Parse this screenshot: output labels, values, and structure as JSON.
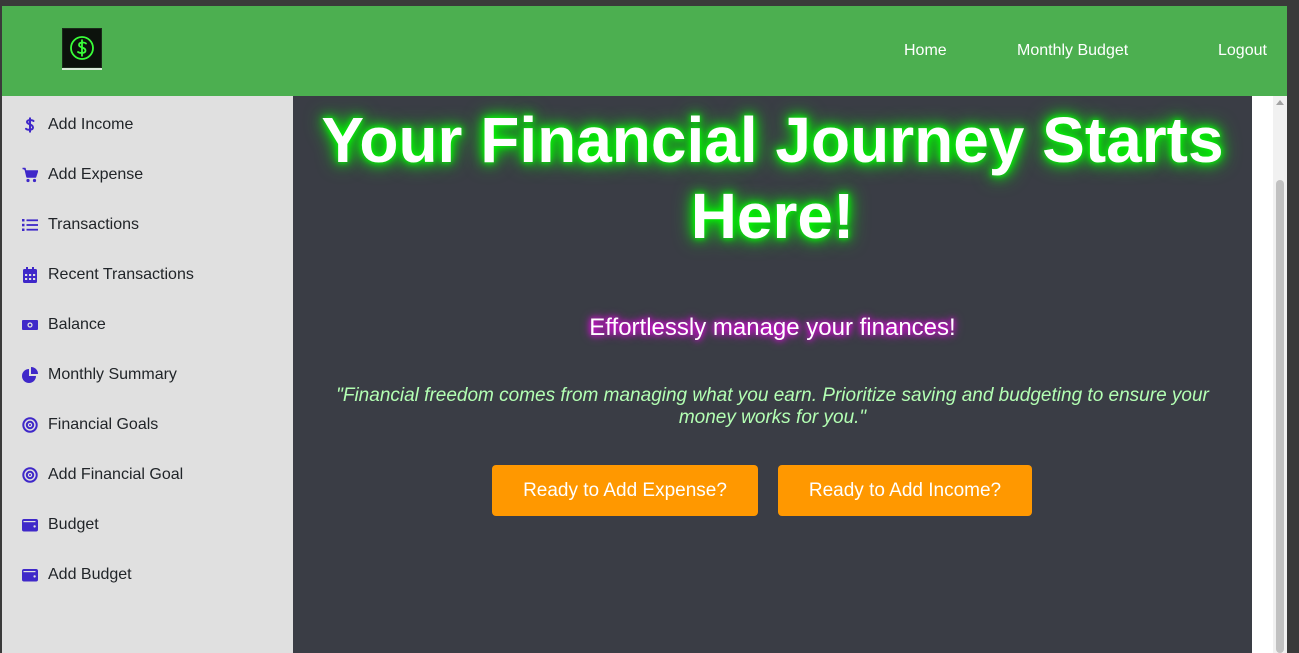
{
  "navbar": {
    "logo_icon": "dollar-sign-neon-icon",
    "background": "#4caf50",
    "links": {
      "home": "Home",
      "monthly_budget": "Monthly Budget",
      "logout": "Logout"
    }
  },
  "sidebar": {
    "items": [
      {
        "label": "Add Income",
        "icon": "dollar-icon"
      },
      {
        "label": "Add Expense",
        "icon": "cart-icon"
      },
      {
        "label": "Transactions",
        "icon": "list-icon"
      },
      {
        "label": "Recent Transactions",
        "icon": "calendar-icon"
      },
      {
        "label": "Balance",
        "icon": "money-bill-icon"
      },
      {
        "label": "Monthly Summary",
        "icon": "pie-chart-icon"
      },
      {
        "label": "Financial Goals",
        "icon": "target-icon"
      },
      {
        "label": "Add Financial Goal",
        "icon": "target-icon"
      },
      {
        "label": "Budget",
        "icon": "wallet-icon"
      },
      {
        "label": "Add Budget",
        "icon": "wallet-icon"
      }
    ],
    "icon_color": "#3f28c9"
  },
  "main": {
    "title_line1": "Your Financial Journey Starts",
    "title_line2": "Here!",
    "subtitle": "Effortlessly manage your finances!",
    "quote": "\"Financial freedom comes from managing what you earn. Prioritize saving and budgeting to ensure your money works for you.\"",
    "buttons": {
      "add_expense": "Ready to Add Expense?",
      "add_income": "Ready to Add Income?"
    },
    "accent_color": "#ff9800",
    "glow_color": "#00ff00"
  }
}
